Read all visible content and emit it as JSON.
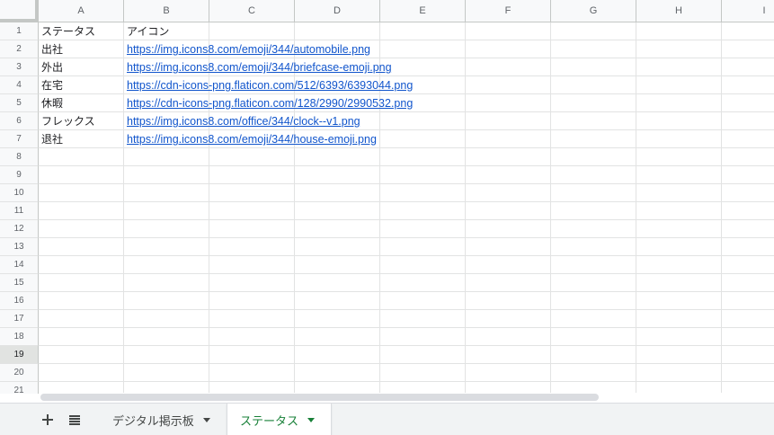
{
  "columns": [
    "A",
    "B",
    "C",
    "D",
    "E",
    "F",
    "G",
    "H",
    "I"
  ],
  "rows": [
    "1",
    "2",
    "3",
    "4",
    "5",
    "6",
    "7",
    "8",
    "9",
    "10",
    "11",
    "12",
    "13",
    "14",
    "15",
    "16",
    "17",
    "18",
    "19",
    "20",
    "21"
  ],
  "cells": {
    "A1": "ステータス",
    "B1": "アイコン",
    "A2": "出社",
    "B2": "https://img.icons8.com/emoji/344/automobile.png",
    "A3": "外出",
    "B3": "https://img.icons8.com/emoji/344/briefcase-emoji.png",
    "A4": "在宅",
    "B4": "https://cdn-icons-png.flaticon.com/512/6393/6393044.png",
    "A5": "休暇",
    "B5": "https://cdn-icons-png.flaticon.com/128/2990/2990532.png",
    "A6": "フレックス",
    "B6": "https://img.icons8.com/office/344/clock--v1.png",
    "A7": "退社",
    "B7": "https://img.icons8.com/emoji/344/house-emoji.png"
  },
  "sheet_bar": {
    "add_icon": "plus-icon",
    "list_icon": "menu-lines-icon",
    "tabs": [
      {
        "label": "デジタル掲示板",
        "active": false
      },
      {
        "label": "ステータス",
        "active": true
      }
    ]
  },
  "colors": {
    "link": "#1155cc",
    "active_tab": "#188038",
    "header_bg": "#f8f9fa",
    "grid_line": "#e2e3e3"
  }
}
